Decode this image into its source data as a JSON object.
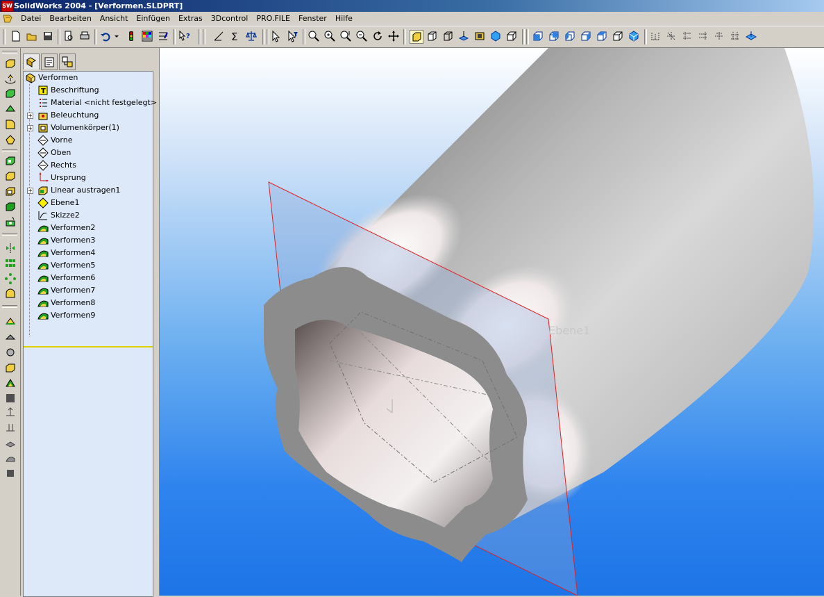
{
  "window": {
    "title": "SolidWorks 2004 - [Verformen.SLDPRT]",
    "app_icon": "SW"
  },
  "menu": {
    "items": [
      "Datei",
      "Bearbeiten",
      "Ansicht",
      "Einfügen",
      "Extras",
      "3Dcontrol",
      "PRO.FILE",
      "Fenster",
      "Hilfe"
    ]
  },
  "toolbar": {
    "icons": [
      "new-icon",
      "open-icon",
      "save-icon",
      "print-preview-icon",
      "print-icon",
      "undo-icon",
      "dropdown-icon",
      "traffic-light-icon",
      "color-palette-icon",
      "options-icon",
      "whats-this-icon",
      "sketch-icon",
      "sum-icon",
      "balance-icon",
      "select-icon",
      "select-filter-icon",
      "zoom-fit-icon",
      "zoom-area-icon",
      "zoom-in-out-icon",
      "zoom-selection-icon",
      "rotate-icon",
      "pan-icon",
      "shaded-icon",
      "hidden-lines-icon",
      "wireframe-icon",
      "section-icon",
      "perspective-icon",
      "shadow-icon",
      "view-orient-icon",
      "front-view-icon",
      "back-view-icon",
      "left-view-icon",
      "right-view-icon",
      "top-view-icon",
      "iso-view-icon",
      "dim-1-icon",
      "dim-2-icon",
      "dim-3-icon",
      "dim-4-icon",
      "dim-5-icon",
      "dim-6-icon",
      "plane-icon"
    ]
  },
  "feature_manager": {
    "root": "Verformen",
    "items": [
      {
        "label": "Beschriftung",
        "icon": "annotations-icon",
        "expand": false
      },
      {
        "label": "Material <nicht festgelegt>",
        "icon": "material-icon",
        "expand": false
      },
      {
        "label": "Beleuchtung",
        "icon": "lighting-icon",
        "expand": true
      },
      {
        "label": "Volumenkörper(1)",
        "icon": "solid-bodies-icon",
        "expand": true
      },
      {
        "label": "Vorne",
        "icon": "plane-icon",
        "expand": false
      },
      {
        "label": "Oben",
        "icon": "plane-icon",
        "expand": false
      },
      {
        "label": "Rechts",
        "icon": "plane-icon",
        "expand": false
      },
      {
        "label": "Ursprung",
        "icon": "origin-icon",
        "expand": false
      },
      {
        "label": "Linear austragen1",
        "icon": "extrude-icon",
        "expand": true
      },
      {
        "label": "Ebene1",
        "icon": "plane-selected-icon",
        "expand": false
      },
      {
        "label": "Skizze2",
        "icon": "sketch-icon",
        "expand": false
      },
      {
        "label": "Verformen2",
        "icon": "deform-icon",
        "expand": false
      },
      {
        "label": "Verformen3",
        "icon": "deform-icon",
        "expand": false
      },
      {
        "label": "Verformen4",
        "icon": "deform-icon",
        "expand": false
      },
      {
        "label": "Verformen5",
        "icon": "deform-icon",
        "expand": false
      },
      {
        "label": "Verformen6",
        "icon": "deform-icon",
        "expand": false
      },
      {
        "label": "Verformen7",
        "icon": "deform-icon",
        "expand": false
      },
      {
        "label": "Verformen8",
        "icon": "deform-icon",
        "expand": false
      },
      {
        "label": "Verformen9",
        "icon": "deform-icon",
        "expand": false
      }
    ]
  },
  "viewport": {
    "plane_label": "Ebene1",
    "background_top": "#ffffff",
    "background_bottom": "#1d74e6",
    "plane_edge_color": "#e02020"
  },
  "colors": {
    "tree_bg": "#dde8f8",
    "rollback_bar": "#e0d000",
    "chrome": "#d4d0c8"
  }
}
